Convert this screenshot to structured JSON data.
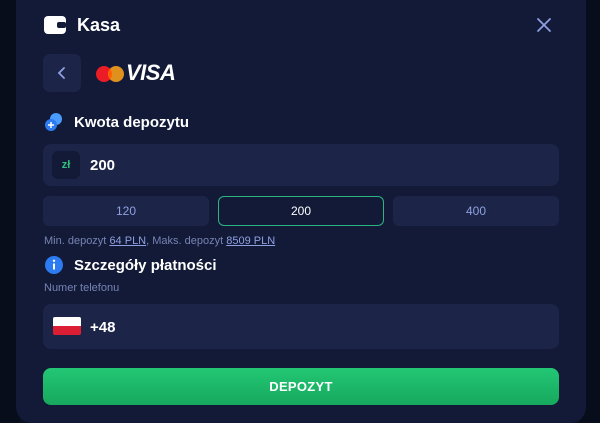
{
  "header": {
    "title": "Kasa"
  },
  "payment_method": {
    "brand": "VISA"
  },
  "deposit_section": {
    "title": "Kwota depozytu"
  },
  "amount": {
    "currency": "zł",
    "value": "200"
  },
  "quick_amounts": [
    {
      "label": "120",
      "selected": false
    },
    {
      "label": "200",
      "selected": true
    },
    {
      "label": "400",
      "selected": false
    }
  ],
  "limits": {
    "min_prefix": "Min. depozyt",
    "min_value": "64 PLN",
    "separator": ", Maks. depozyt",
    "max_value": "8509 PLN"
  },
  "payment_details": {
    "title": "Szczegóły płatności"
  },
  "phone": {
    "label": "Numer telefonu",
    "country_code": "+48"
  },
  "submit": {
    "label": "DEPOZYT"
  },
  "colors": {
    "accent": "#22c774",
    "background": "#121a38",
    "field": "#1c2548"
  }
}
